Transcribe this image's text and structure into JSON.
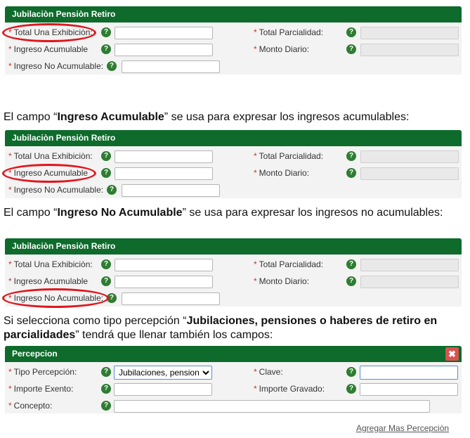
{
  "panel1": {
    "title": "Jubilaciòn Pensiòn Retiro",
    "total_una_exhibicion": "Total Una Exhibiciòn:",
    "total_parcialidad": "Total Parcialidad:",
    "ingreso_acumulable": "Ingreso Acumulable",
    "monto_diario": "Monto Diario:",
    "ingreso_no_acumulable": "Ingreso No Acumulable:"
  },
  "para1": {
    "pre": "El campo “",
    "bold": "Ingreso Acumulable",
    "post": "” se usa para expresar los ingresos acumulables:"
  },
  "panel2": {
    "title": "Jubilaciòn Pensiòn Retiro",
    "total_una_exhibicion": "Total Una Exhibiciòn:",
    "total_parcialidad": "Total Parcialidad:",
    "ingreso_acumulable": "Ingreso Acumulable",
    "monto_diario": "Monto Diario:",
    "ingreso_no_acumulable": "Ingreso No Acumulable:"
  },
  "para2": {
    "pre": "El campo “",
    "bold": "Ingreso No Acumulable",
    "post": "” se usa para expresar los ingresos no acumulables:"
  },
  "panel3": {
    "title": "Jubilaciòn Pensiòn Retiro",
    "total_una_exhibicion": "Total Una Exhibiciòn:",
    "total_parcialidad": "Total Parcialidad:",
    "ingreso_acumulable": "Ingreso Acumulable",
    "monto_diario": "Monto Diario:",
    "ingreso_no_acumulable": "Ingreso No Acumulable:"
  },
  "para3": {
    "pre": "Si selecciona como tipo percepción “",
    "bold": "Jubilaciones, pensiones o haberes de retiro en parcialidades",
    "post": "” tendrá que llenar también los campos:"
  },
  "percepcion": {
    "title": "Percepcion",
    "tipo_percepcion": "Tipo Percepción:",
    "tipo_value": "Jubilaciones, pensiones",
    "clave": "Clave:",
    "importe_exento": "Importe Exento:",
    "importe_gravado": "Importe Gravado:",
    "concepto": "Concepto:"
  },
  "agregar_link": "Agregar Mas Percepciòn",
  "colors": {
    "header_green": "#0e6b2c",
    "highlight_red": "#e0161e",
    "close_red": "#d9534f"
  }
}
